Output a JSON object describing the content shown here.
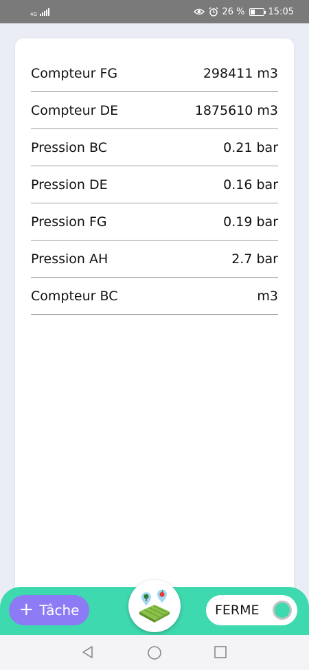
{
  "status_bar": {
    "network": "4G",
    "battery_percent": "26 %",
    "time": "15:05",
    "icons": [
      "eye-icon",
      "alarm-icon",
      "battery-icon",
      "signal-icon"
    ]
  },
  "readings": [
    {
      "label": "Compteur FG",
      "value": "298411 m3"
    },
    {
      "label": "Compteur DE",
      "value": "1875610 m3"
    },
    {
      "label": "Pression BC",
      "value": "0.21 bar"
    },
    {
      "label": "Pression DE",
      "value": "0.16 bar"
    },
    {
      "label": "Pression FG",
      "value": "0.19 bar"
    },
    {
      "label": "Pression AH",
      "value": "2.7 bar"
    },
    {
      "label": "Compteur BC",
      "value": "m3"
    }
  ],
  "bottom_bar": {
    "task_label": "Tâche",
    "toggle_label": "FERME",
    "logo_icon": "farm-field-icon"
  },
  "colors": {
    "accent_green": "#3fd9b0",
    "task_purple": "#8c7bf4",
    "background": "#eaedf6"
  }
}
